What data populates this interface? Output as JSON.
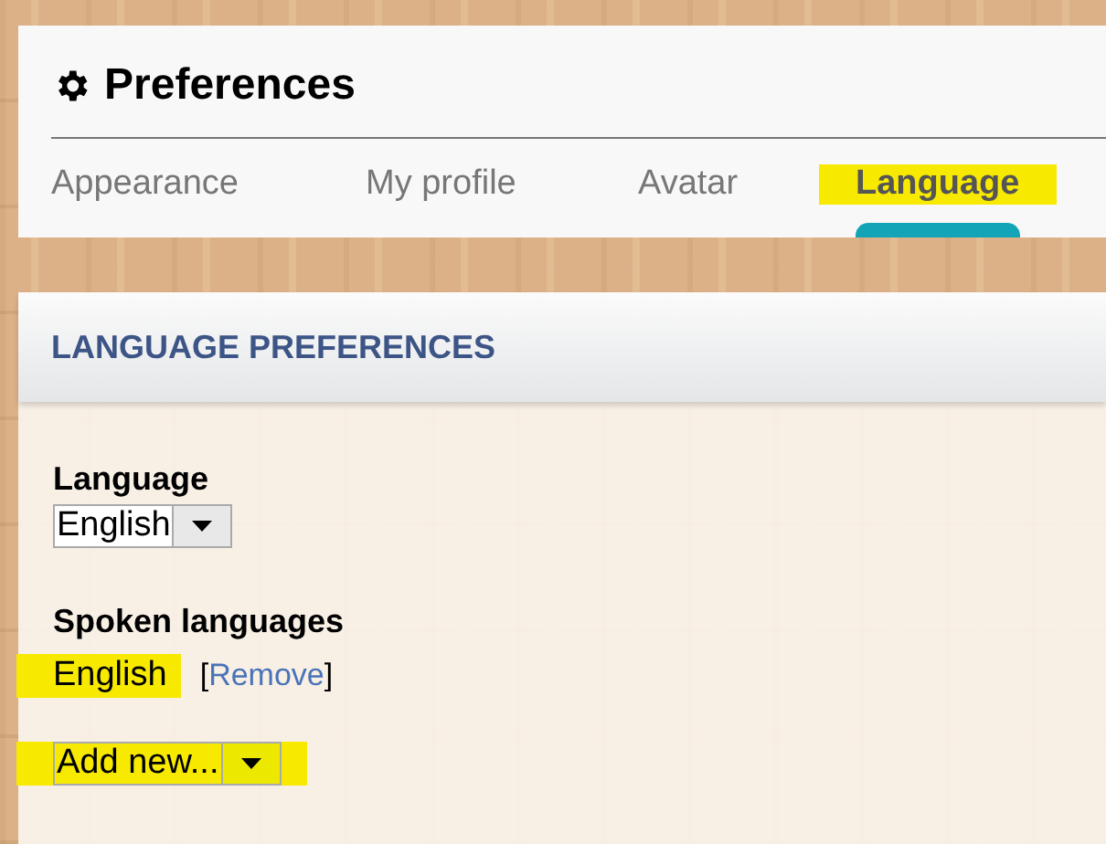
{
  "header": {
    "title": "Preferences"
  },
  "tabs": [
    {
      "label": "Appearance",
      "selected": false,
      "highlighted": false
    },
    {
      "label": "My profile",
      "selected": false,
      "highlighted": false
    },
    {
      "label": "Avatar",
      "selected": false,
      "highlighted": false
    },
    {
      "label": "Language",
      "selected": true,
      "highlighted": true
    }
  ],
  "section": {
    "title": "LANGUAGE PREFERENCES",
    "language": {
      "label": "Language",
      "value": "English",
      "highlighted": false
    },
    "spoken": {
      "label": "Spoken languages",
      "items": [
        {
          "name": "English",
          "highlighted": true,
          "bracket_open": "[",
          "remove_link": "Remove",
          "bracket_close": "]"
        }
      ],
      "add": {
        "value": "Add new...",
        "highlighted": true
      }
    }
  }
}
